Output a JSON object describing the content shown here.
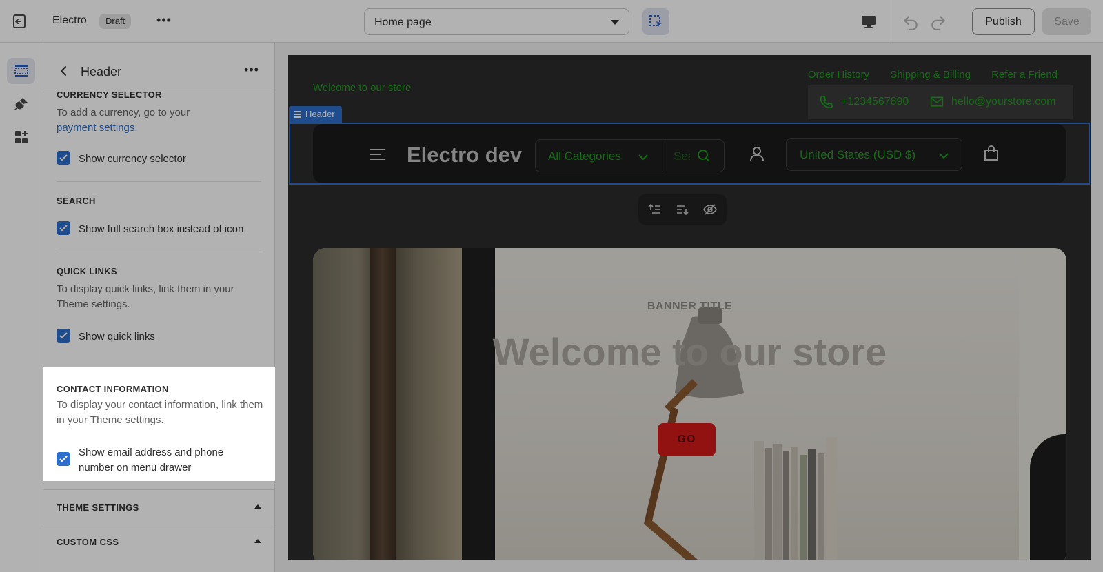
{
  "topbar": {
    "store_name": "Electro",
    "status_badge": "Draft",
    "page_selector": "Home page",
    "publish_label": "Publish",
    "save_label": "Save"
  },
  "panel": {
    "title": "Header",
    "sections": {
      "currency": {
        "title": "CURRENCY SELECTOR",
        "help_text": "To add a currency, go to your",
        "help_link": "payment settings.",
        "checkbox_label": "Show currency selector",
        "checked": true
      },
      "search": {
        "title": "SEARCH",
        "checkbox_label": "Show full search box instead of icon",
        "checked": true
      },
      "quick_links": {
        "title": "QUICK LINKS",
        "help_text": "To display quick links, link them in your Theme settings.",
        "checkbox_label": "Show quick links",
        "checked": true
      },
      "contact": {
        "title": "CONTACT INFORMATION",
        "help_text": "To display your contact information, link them in your Theme settings.",
        "checkbox_label": "Show email address and phone number on menu drawer",
        "checked": true
      }
    },
    "accordions": [
      "THEME SETTINGS",
      "CUSTOM CSS"
    ]
  },
  "preview": {
    "top_links": [
      "Order History",
      "Shipping & Billing",
      "Refer a Friend"
    ],
    "welcome": "Welcome to our store",
    "phone": "+1234567890",
    "email": "hello@yourstore.com",
    "header_tag": "Header",
    "logo": "Electro dev",
    "category_select": "All Categories",
    "search_placeholder": "Search",
    "currency": "United States (USD $)",
    "banner": {
      "kicker": "BANNER TITLE",
      "title": "Welcome to our store",
      "button": "GO"
    }
  },
  "colors": {
    "accent": "#2c6ecb",
    "preview_text": "#1d9b1d",
    "banner_button": "#d21b1b"
  }
}
